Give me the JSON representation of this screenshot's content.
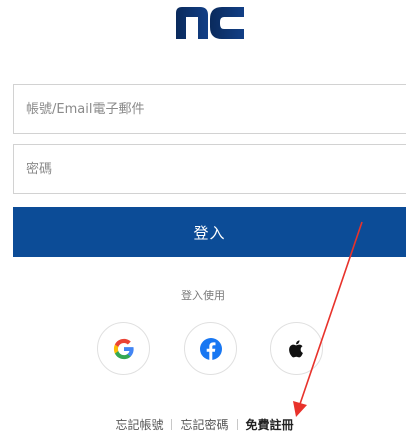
{
  "brand": {
    "logo_text": "nc"
  },
  "form": {
    "account_placeholder": "帳號/Email電子郵件",
    "password_placeholder": "密碼",
    "login_label": "登入"
  },
  "social": {
    "caption": "登入使用",
    "providers": [
      {
        "name": "google",
        "icon": "google-icon"
      },
      {
        "name": "facebook",
        "icon": "facebook-icon",
        "color": "#1877f2"
      },
      {
        "name": "apple",
        "icon": "apple-icon",
        "color": "#111111"
      }
    ]
  },
  "footer": {
    "forgot_account": "忘記帳號",
    "forgot_password": "忘記密碼",
    "register": "免費註冊"
  },
  "colors": {
    "primary": "#0c4c97",
    "annotation_arrow": "#e8322b"
  }
}
